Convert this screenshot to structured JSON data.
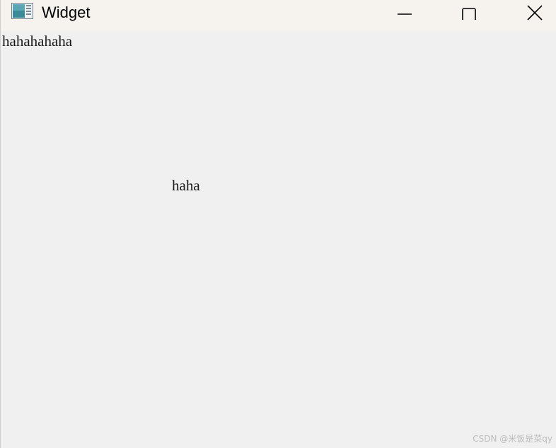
{
  "window": {
    "title": "Widget",
    "icon": "app-window-icon",
    "controls": {
      "minimize_icon": "minimize-icon",
      "maximize_icon": "maximize-icon",
      "close_icon": "close-icon"
    }
  },
  "content": {
    "label_top": "hahahahaha",
    "label_middle": "haha"
  },
  "watermark": "CSDN @米饭是菜qy",
  "colors": {
    "titlebar_bg": "#f6f3ef",
    "client_bg": "#f0f0f0",
    "text": "#1a1a1a"
  }
}
